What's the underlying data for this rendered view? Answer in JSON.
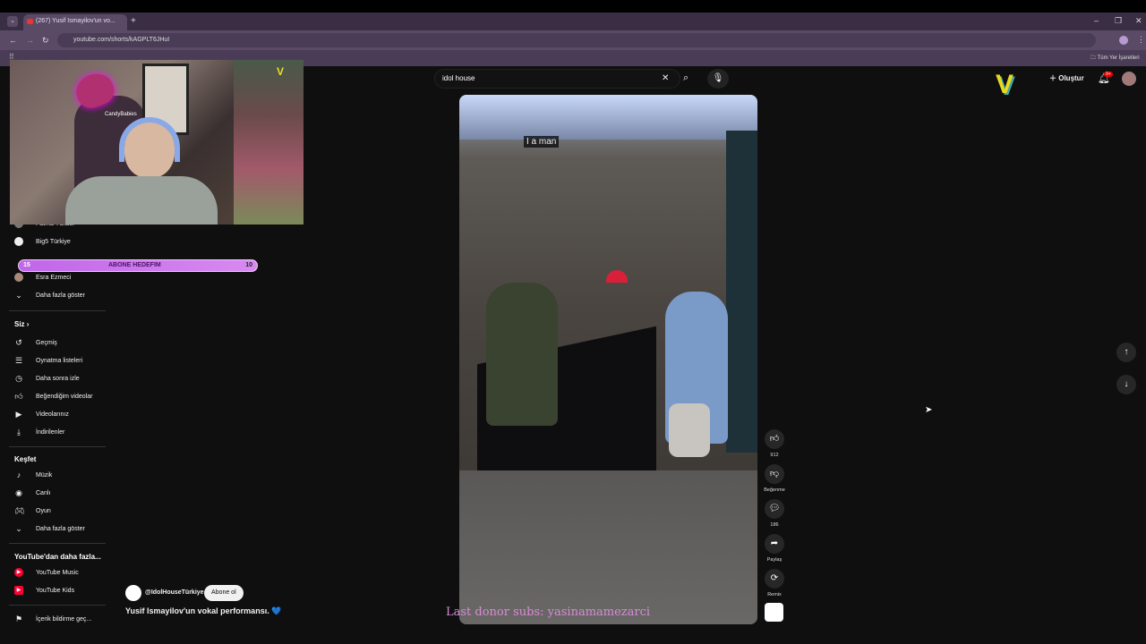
{
  "browser": {
    "tab_title": "(267) Yusif Ismayilov'un vo...",
    "url": "youtube.com/shorts/kAGPLT6JHuI",
    "bookmarks_label": "Tüm Yer İşaretleri"
  },
  "webcam": {
    "channel_text": "CandyBabies"
  },
  "subscriber_goal": {
    "start": "15",
    "label": "ABONE HEDEFIM",
    "end": "10"
  },
  "sidebar": {
    "subs": [
      {
        "label": "Fatma Yüksel",
        "icon": "avatar-icon"
      },
      {
        "label": "Big5 Türkiye",
        "icon": "avatar-icon"
      },
      {
        "label": "Esra Ezmeci",
        "icon": "avatar-icon"
      }
    ],
    "more_label": "Daha fazla göster",
    "you_title": "Siz",
    "you_items": [
      {
        "label": "Geçmiş",
        "icon": "history-icon"
      },
      {
        "label": "Oynatma listeleri",
        "icon": "playlist-icon"
      },
      {
        "label": "Daha sonra izle",
        "icon": "clock-icon"
      },
      {
        "label": "Beğendiğim videolar",
        "icon": "like-icon"
      },
      {
        "label": "Videolarınız",
        "icon": "video-icon"
      },
      {
        "label": "İndirilenler",
        "icon": "download-icon"
      }
    ],
    "explore_title": "Keşfet",
    "explore_items": [
      {
        "label": "Müzik",
        "icon": "music-icon"
      },
      {
        "label": "Canlı",
        "icon": "live-icon"
      },
      {
        "label": "Oyun",
        "icon": "game-icon"
      }
    ],
    "explore_more": "Daha fazla göster",
    "more_yt_title": "YouTube'dan daha fazla...",
    "more_yt_items": [
      {
        "label": "YouTube Music",
        "icon": "yt-music-icon"
      },
      {
        "label": "YouTube Kids",
        "icon": "yt-kids-icon"
      }
    ],
    "report_label": "İçerik bildirme geç..."
  },
  "header": {
    "search_value": "idol house",
    "create_label": "Oluştur",
    "notif_badge": "9+"
  },
  "short": {
    "caption": "I a man",
    "channel": "@IdolHouseTürkiye",
    "subscribe_label": "Abone ol",
    "title": "Yusif Ismayilov'un vokal performansı. 💙",
    "likes": "912",
    "dislike_label": "Beğenme",
    "comments": "186",
    "share_label": "Paylaş",
    "remix_label": "Remix"
  },
  "overlay": {
    "donor_text": "Last donor subs: yasinamamezarci"
  }
}
